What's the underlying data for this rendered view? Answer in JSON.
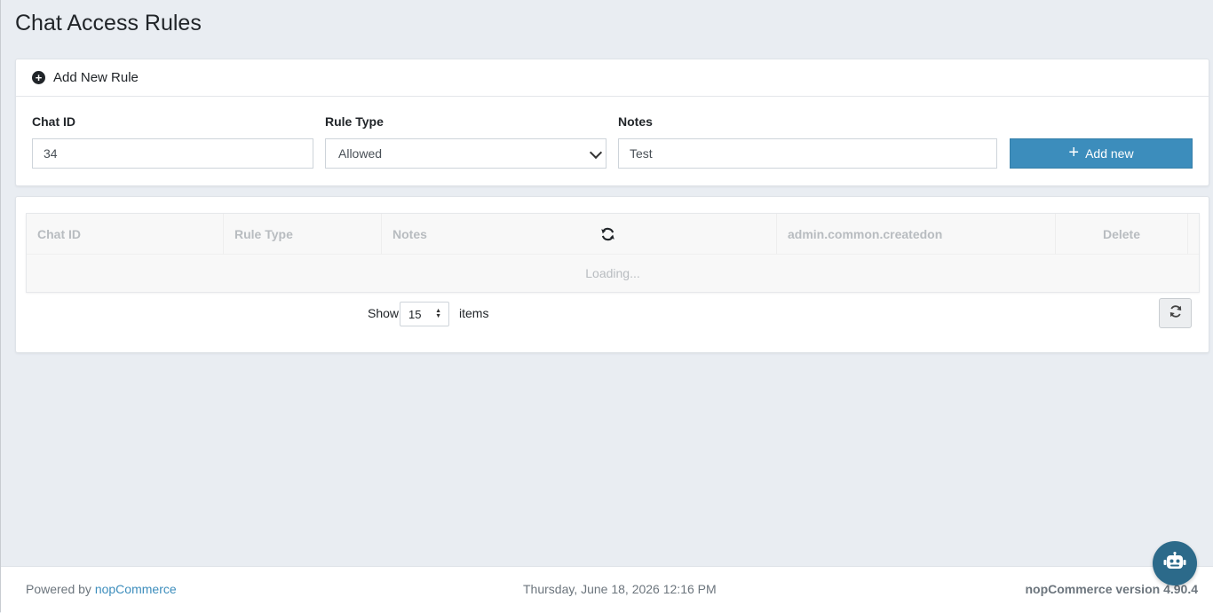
{
  "page": {
    "title": "Chat Access Rules"
  },
  "add_rule": {
    "header": "Add New Rule",
    "chat_id_label": "Chat ID",
    "chat_id_value": "34",
    "rule_type_label": "Rule Type",
    "rule_type_value": "Allowed",
    "notes_label": "Notes",
    "notes_value": "Test",
    "add_button": "Add new"
  },
  "grid": {
    "columns": [
      "Chat ID",
      "Rule Type",
      "Notes",
      "",
      "admin.common.createdon",
      "Delete"
    ],
    "loading_text": "Loading...",
    "pager": {
      "show_label": "Show",
      "page_size": "15",
      "items_label": "items"
    }
  },
  "footer": {
    "powered_by": "Powered by",
    "powered_link": "nopCommerce",
    "datetime": "Thursday, June 18, 2026 12:16 PM",
    "version": "nopCommerce version 4.90.4"
  },
  "colors": {
    "primary": "#3c8dbc",
    "chatbot": "#2c6a8a"
  },
  "icons": [
    "plus-circle-icon",
    "plus-icon",
    "chevron-down-icon",
    "sync-icon",
    "refresh-icon",
    "robot-icon"
  ]
}
